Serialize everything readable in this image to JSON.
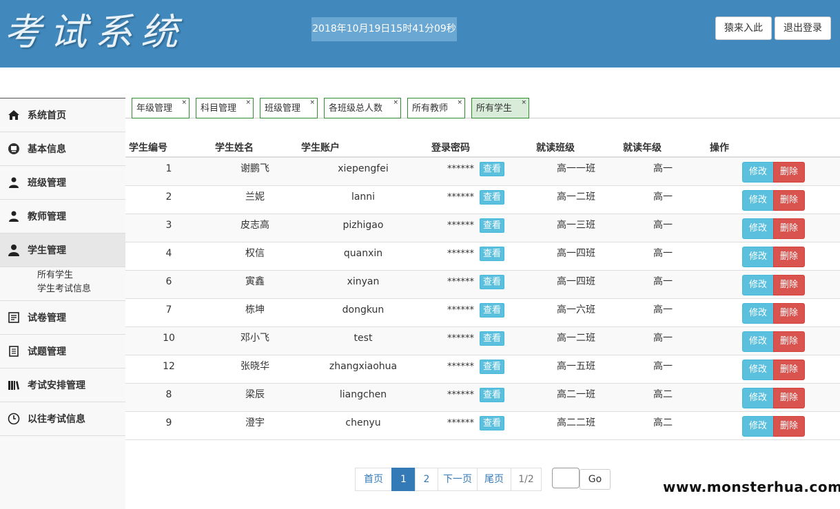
{
  "header": {
    "logo": "考试系统",
    "datetime": "2018年10月19日15时41分09秒",
    "btn_guest": "猿来入此",
    "btn_logout": "退出登录",
    "bg_color": "#4189bd"
  },
  "sidebar": {
    "items": [
      {
        "label": "系统首页",
        "icon": "home-icon"
      },
      {
        "label": "基本信息",
        "icon": "monitor-icon"
      },
      {
        "label": "班级管理",
        "icon": "user-icon"
      },
      {
        "label": "教师管理",
        "icon": "user-icon"
      },
      {
        "label": "学生管理",
        "icon": "user-icon"
      },
      {
        "label": "试卷管理",
        "icon": "document-icon"
      },
      {
        "label": "试题管理",
        "icon": "notebook-icon"
      },
      {
        "label": "考试安排管理",
        "icon": "books-icon"
      },
      {
        "label": "以往考试信息",
        "icon": "clock-icon"
      }
    ],
    "sub_items": [
      "所有学生",
      "学生考试信息"
    ]
  },
  "tabs": [
    {
      "label": "年级管理"
    },
    {
      "label": "科目管理"
    },
    {
      "label": "班级管理"
    },
    {
      "label": "各班级总人数"
    },
    {
      "label": "所有教师"
    },
    {
      "label": "所有学生"
    }
  ],
  "table": {
    "headers": [
      "学生编号",
      "学生姓名",
      "学生账户",
      "登录密码",
      "就读班级",
      "就读年级",
      "操作"
    ],
    "view_label": "查看",
    "edit_label": "修改",
    "delete_label": "删除",
    "rows": [
      {
        "id": "1",
        "name": "谢鹏飞",
        "account": "xiepengfei",
        "pw": "******",
        "cls": "高一一班",
        "grade": "高一"
      },
      {
        "id": "2",
        "name": "兰妮",
        "account": "lanni",
        "pw": "******",
        "cls": "高一二班",
        "grade": "高一"
      },
      {
        "id": "3",
        "name": "皮志高",
        "account": "pizhigao",
        "pw": "******",
        "cls": "高一三班",
        "grade": "高一"
      },
      {
        "id": "4",
        "name": "权信",
        "account": "quanxin",
        "pw": "******",
        "cls": "高一四班",
        "grade": "高一"
      },
      {
        "id": "6",
        "name": "寅鑫",
        "account": "xinyan",
        "pw": "******",
        "cls": "高一四班",
        "grade": "高一"
      },
      {
        "id": "7",
        "name": "栋坤",
        "account": "dongkun",
        "pw": "******",
        "cls": "高一六班",
        "grade": "高一"
      },
      {
        "id": "10",
        "name": "邓小飞",
        "account": "test",
        "pw": "******",
        "cls": "高一二班",
        "grade": "高一"
      },
      {
        "id": "12",
        "name": "张晓华",
        "account": "zhangxiaohua",
        "pw": "******",
        "cls": "高一五班",
        "grade": "高一"
      },
      {
        "id": "8",
        "name": "梁辰",
        "account": "liangchen",
        "pw": "******",
        "cls": "高二一班",
        "grade": "高二"
      },
      {
        "id": "9",
        "name": "澄宇",
        "account": "chenyu",
        "pw": "******",
        "cls": "高二二班",
        "grade": "高二"
      }
    ]
  },
  "pager": {
    "first": "首页",
    "page1": "1",
    "page2": "2",
    "next": "下一页",
    "last": "尾页",
    "info": "1/2",
    "go": "Go"
  },
  "watermark": "www.monsterhua.com"
}
